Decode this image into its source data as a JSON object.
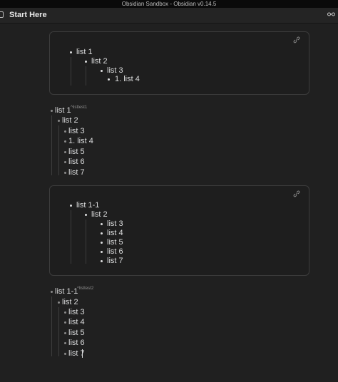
{
  "window": {
    "title": "Obsidian Sandbox - Obsidian v0.14.5"
  },
  "header": {
    "note_title": "Start Here",
    "reading_mode_icon": "glasses-icon",
    "file_icon": "document-icon"
  },
  "embed1": {
    "link_icon": "link-icon",
    "items": [
      {
        "text": "list 1"
      },
      {
        "text": "list 2"
      },
      {
        "text": "list 3"
      },
      {
        "text": "1. list 4"
      }
    ]
  },
  "block1": {
    "tag": "^listtest1",
    "items": [
      {
        "text": "list 1"
      },
      {
        "text": "list 2"
      },
      {
        "text": "list 3"
      },
      {
        "text": "1. list 4"
      },
      {
        "text": "list 5"
      },
      {
        "text": "list 6"
      },
      {
        "text": "list 7"
      }
    ]
  },
  "embed2": {
    "link_icon": "link-icon",
    "items": [
      {
        "text": "list 1-1"
      },
      {
        "text": "list 2"
      },
      {
        "text": "list 3"
      },
      {
        "text": "list 4"
      },
      {
        "text": "list 5"
      },
      {
        "text": "list 6"
      },
      {
        "text": "list 7"
      }
    ]
  },
  "block2": {
    "tag": "^listtest2",
    "items": [
      {
        "text": "list 1-1"
      },
      {
        "text": "list 2"
      },
      {
        "text": "list 3"
      },
      {
        "text": "list 4"
      },
      {
        "text": "list 5"
      },
      {
        "text": "list 6"
      },
      {
        "text": "list 7"
      }
    ]
  }
}
